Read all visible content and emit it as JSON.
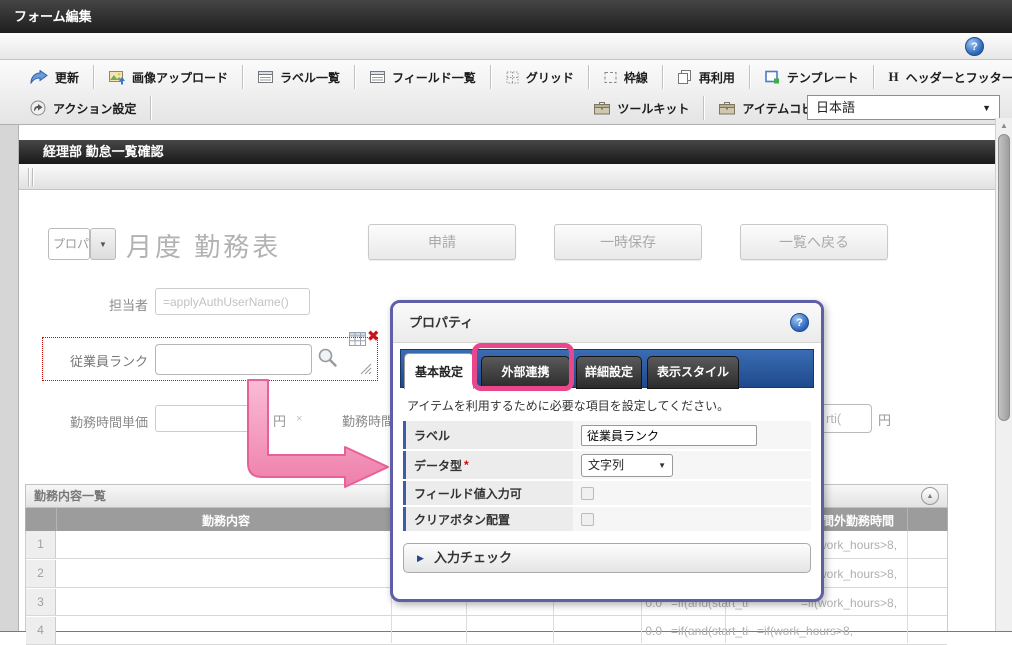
{
  "window": {
    "title": "フォーム編集"
  },
  "toolbar": {
    "row1": [
      {
        "label": "更新",
        "icon": "update-icon"
      },
      {
        "label": "画像アップロード",
        "icon": "image-upload-icon"
      },
      {
        "label": "ラベル一覧",
        "icon": "label-list-icon"
      },
      {
        "label": "フィールド一覧",
        "icon": "field-list-icon"
      },
      {
        "label": "グリッド",
        "icon": "grid-icon"
      },
      {
        "label": "枠線",
        "icon": "border-icon"
      },
      {
        "label": "再利用",
        "icon": "reuse-icon"
      },
      {
        "label": "テンプレート",
        "icon": "template-icon"
      },
      {
        "label": "ヘッダーとフッター",
        "icon": "header-footer-icon"
      }
    ],
    "row2": [
      {
        "label": "アクション設定",
        "icon": "action-settings-icon"
      },
      {
        "label": "ツールキット",
        "icon": "toolkit-icon"
      },
      {
        "label": "アイテムコピー",
        "icon": "item-copy-icon"
      }
    ],
    "language_select": {
      "value": "日本語"
    }
  },
  "form": {
    "section_title": "経理部 勤怠一覧確認",
    "title_combo_value": "プロパ",
    "page_title": "月度 勤務表",
    "buttons": {
      "submit": "申請",
      "temp_save": "一時保存",
      "back": "一覧へ戻る"
    },
    "owner": {
      "label": "担当者",
      "value": "=applyAuthUserName()"
    },
    "employee_rank": {
      "label": "従業員ランク",
      "value": ""
    },
    "unit_price": {
      "label": "勤務時間単価",
      "suffix": "円",
      "multiply": "×"
    },
    "work_hours": {
      "label": "勤務時間",
      "value_fragment": "rti(",
      "suffix": "円"
    }
  },
  "dialog": {
    "title": "プロパティ",
    "tabs": [
      {
        "label": "基本設定",
        "active": true
      },
      {
        "label": "外部連携",
        "active": false,
        "highlighted": true
      },
      {
        "label": "詳細設定",
        "active": false
      },
      {
        "label": "表示スタイル",
        "active": false
      }
    ],
    "description": "アイテムを利用するために必要な項目を設定してください。",
    "fields": [
      {
        "label": "ラベル",
        "type": "text",
        "value": "従業員ランク"
      },
      {
        "label": "データ型",
        "required": "*",
        "type": "select",
        "value": "文字列"
      },
      {
        "label": "フィールド値入力可",
        "type": "checkbox",
        "checked": false
      },
      {
        "label": "クリアボタン配置",
        "type": "checkbox",
        "checked": false
      }
    ],
    "accordion_label": "入力チェック"
  },
  "worklist": {
    "title": "勤務内容一覧",
    "columns": {
      "main": "勤務内容",
      "overtime": "時間外勤務時間"
    },
    "row_nums": [
      "1",
      "2",
      "3",
      "4"
    ],
    "cells": {
      "hours": "0.0",
      "start_formula": "=if(and(start_time>",
      "overtime_formula": "=if(work_hours>8,"
    }
  },
  "colors": {
    "highlight_pink": "#e8488a",
    "tab_blue": "#2b5aa7",
    "selection_red": "#cc0000",
    "titlebar_dark": "#2b2b2b"
  }
}
